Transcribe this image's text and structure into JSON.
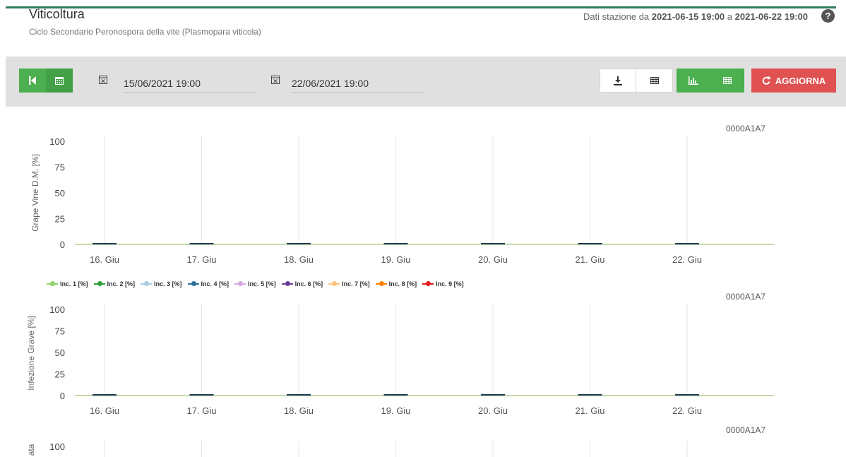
{
  "header": {
    "title": "Viticoltura",
    "subtitle": "Ciclo Secondario Peronospora della vite (Plasmopara viticola)",
    "range_prefix": "Dati stazione da",
    "range_from": "2021-06-15 19:00",
    "range_mid": "a",
    "range_to": "2021-06-22 19:00",
    "help_icon": "question-circle-icon"
  },
  "toolbar": {
    "first_icon": "skip-back-icon",
    "calendar_icon": "calendar-icon",
    "date_from": "15/06/2021 19:00",
    "date_to": "22/06/2021 19:00",
    "download_icon": "download-icon",
    "table_icon": "table-icon",
    "chart_view_icon": "bar-chart-icon",
    "table_view_icon": "table-icon",
    "refresh_label": "AGGIORNA",
    "refresh_icon": "refresh-icon",
    "colors": {
      "green": "#4caf50",
      "red": "#e05151",
      "bar": "#e0e0e0"
    }
  },
  "legend": {
    "items": [
      {
        "label": "Inc. 1 [%]",
        "color": "#90d16b"
      },
      {
        "label": "Inc. 2 [%]",
        "color": "#2f9e3a"
      },
      {
        "label": "Inc. 3 [%]",
        "color": "#a9cbe4"
      },
      {
        "label": "Inc. 4 [%]",
        "color": "#2a6f97"
      },
      {
        "label": "Inc. 5 [%]",
        "color": "#d5a9df"
      },
      {
        "label": "Inc. 6 [%]",
        "color": "#6a3d9a"
      },
      {
        "label": "Inc. 7 [%]",
        "color": "#fbc27a"
      },
      {
        "label": "Inc. 8 [%]",
        "color": "#ff7f00"
      },
      {
        "label": "Inc. 9 [%]",
        "color": "#e31a1c"
      }
    ]
  },
  "chart_data": [
    {
      "type": "line",
      "station_id": "0000A1A7",
      "ylabel": "Grape Vine D.M. [%]",
      "ylim": [
        0,
        100
      ],
      "yticks": [
        "100",
        "75",
        "50",
        "25",
        "0"
      ],
      "categories": [
        "16. Giu",
        "17. Giu",
        "18. Giu",
        "19. Giu",
        "20. Giu",
        "21. Giu",
        "22. Giu"
      ],
      "values": [
        0,
        0,
        0,
        0,
        0,
        0,
        0
      ]
    },
    {
      "type": "line",
      "station_id": "0000A1A7",
      "ylabel": "Infezione Grave [%]",
      "ylim": [
        0,
        100
      ],
      "yticks": [
        "100",
        "75",
        "50",
        "25",
        "0"
      ],
      "categories": [
        "16. Giu",
        "17. Giu",
        "18. Giu",
        "19. Giu",
        "20. Giu",
        "21. Giu",
        "22. Giu"
      ],
      "values": [
        0,
        0,
        0,
        0,
        0,
        0,
        0
      ]
    },
    {
      "type": "line",
      "station_id": "0000A1A7",
      "ylabel": "ata",
      "ylim": [
        0,
        100
      ],
      "yticks": [
        "100"
      ],
      "categories": [],
      "values": []
    }
  ]
}
